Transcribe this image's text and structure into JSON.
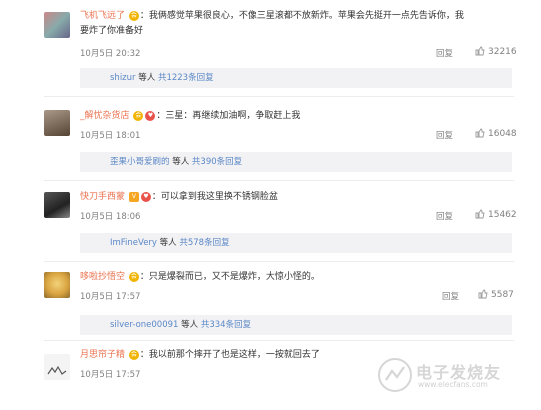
{
  "comments": [
    {
      "username": "飞机飞远了",
      "text_line1": "：我俩感觉苹果很良心，不像三星滚都不放新炸。苹果会先挺开一点先告诉你，我",
      "text_line2": "要炸了你准备好",
      "date": "10月5日 20:32",
      "reply_label": "回复",
      "likes": "32216",
      "sub_user": "shizur",
      "sub_mid": " 等人 ",
      "sub_count": "共1223条回复"
    },
    {
      "username": "_解忧杂货店",
      "text_line1": "：三星：再继续加油啊，争取赶上我",
      "date": "10月5日 18:01",
      "reply_label": "回复",
      "likes": "16048",
      "sub_user": "歪果小哥爱刷的",
      "sub_mid": " 等人 ",
      "sub_count": "共390条回复"
    },
    {
      "username": "快刀手西蒙",
      "text_line1": "：可以拿到我这里换不锈钢脸盆",
      "date": "10月5日 18:06",
      "reply_label": "回复",
      "likes": "15462",
      "sub_user": "ImFineVery",
      "sub_mid": " 等人 ",
      "sub_count": "共578条回复"
    },
    {
      "username": "哆啦抄悟空",
      "text_line1": "：只是爆裂而已，又不是爆炸，大惊小怪的。",
      "date": "10月5日 17:57",
      "reply_label": "回复",
      "likes": "5587",
      "sub_user": "silver-one00091",
      "sub_mid": " 等人 ",
      "sub_count": "共334条回复"
    },
    {
      "username": "月思帘子精",
      "text_line1": "：我以前那个摔开了也是这样，一按就回去了",
      "date": "10月5日 17:57"
    }
  ],
  "watermark": {
    "title": "电子发烧友",
    "url": "www.elecfans.com"
  },
  "colors": {
    "username": "#eb7350",
    "link": "#5a87c5",
    "bar": "#f2f2f5"
  }
}
